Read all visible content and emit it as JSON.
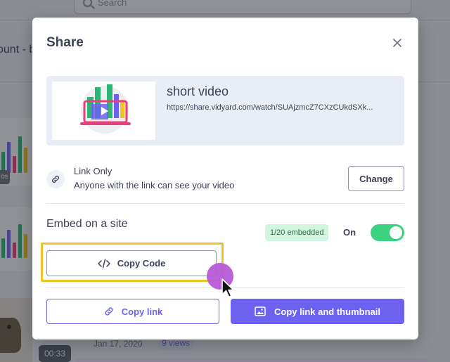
{
  "background": {
    "search_placeholder": "Search",
    "page_title_partial": "ount - b",
    "badge_partial": "os",
    "duration": "00:33",
    "date": "Jan 17, 2020",
    "views": "9 views"
  },
  "modal": {
    "title": "Share",
    "close_icon": "close-icon"
  },
  "video": {
    "name": "short video",
    "url": "https://share.vidyard.com/watch/SUAjzmcZ7CXzCUkdSXk..."
  },
  "privacy": {
    "icon": "link-icon",
    "title": "Link Only",
    "description": "Anyone with the link can see your video",
    "change_label": "Change"
  },
  "embed": {
    "title": "Embed on a site",
    "count": "1/20 embedded",
    "toggle_label": "On",
    "toggle_state": "on",
    "copy_code_label": "Copy Code",
    "copy_code_icon": "code-icon"
  },
  "actions": {
    "copy_link_label": "Copy link",
    "copy_link_icon": "link-icon",
    "copy_thumb_label": "Copy link and thumbnail",
    "copy_thumb_icon": "image-icon"
  },
  "colors": {
    "primary": "#6d62ef",
    "toggle_on": "#3dd27f",
    "highlight": "#f2c324",
    "click_indicator": "#b65ad8"
  }
}
